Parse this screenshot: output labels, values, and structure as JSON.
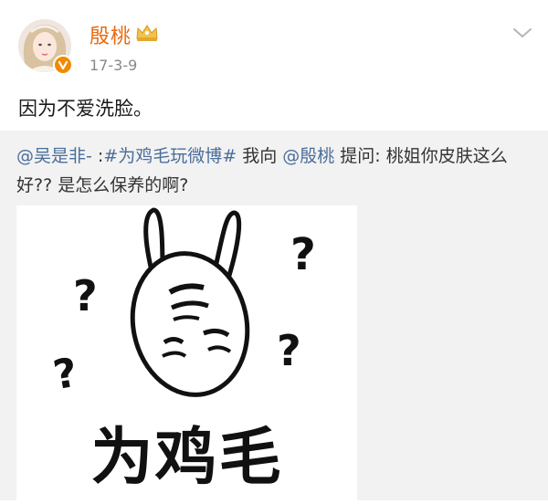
{
  "post": {
    "username": "殷桃",
    "timestamp": "17-3-9",
    "text": "因为不爱洗脸。",
    "vip_badge_icon": "vip-crown-icon",
    "verify_icon": "verified-v-icon",
    "menu_icon": "chevron-down-icon"
  },
  "retweet": {
    "mention_user": "@吴是非-",
    "sep": " :",
    "hashtag": "#为鸡毛玩微博#",
    "mid1": " 我向 ",
    "mention_target": "@殷桃",
    "mid2": " 提问: 桃姐你皮肤这么好?? 是怎么保养的啊?",
    "meme_caption": "为鸡毛"
  },
  "colors": {
    "username": "#e86b10",
    "link": "#4a6e9a",
    "retweet_bg": "#f2f2f2",
    "badge": "#f08a00"
  }
}
